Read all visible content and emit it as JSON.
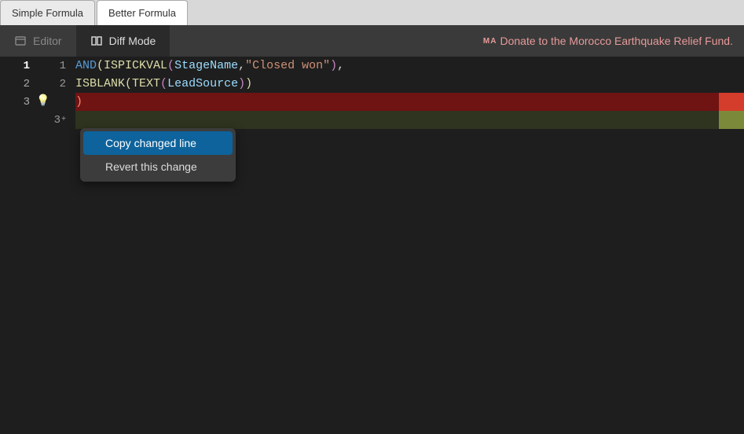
{
  "top_tabs": {
    "simple": "Simple Formula",
    "better": "Better Formula"
  },
  "toolbar": {
    "editor_label": "Editor",
    "diff_label": "Diff Mode",
    "donate_prefix": "MA",
    "donate_text": "Donate to the Morocco Earthquake Relief Fund."
  },
  "gutter_left": [
    "1",
    "2",
    "3",
    ""
  ],
  "gutter_right": [
    "1",
    "2",
    "",
    "3"
  ],
  "gutter_right_suffix": [
    "",
    "",
    "",
    "+"
  ],
  "code": {
    "line1": {
      "and": "AND",
      "p1": "(",
      "ispickval": "ISPICKVAL",
      "p2": "(",
      "stagename": "StageName",
      "comma": ",",
      "str": "\"Closed won\"",
      "p2c": ")",
      "trail": ","
    },
    "line2": {
      "isblank": "ISBLANK",
      "p1": "(",
      "text": "TEXT",
      "p2": "(",
      "leadsource": "LeadSource",
      "p2c": ")",
      "p1c": ")"
    },
    "line3": {
      "close": ")"
    }
  },
  "context_menu": {
    "copy": "Copy changed line",
    "revert": "Revert this change"
  }
}
